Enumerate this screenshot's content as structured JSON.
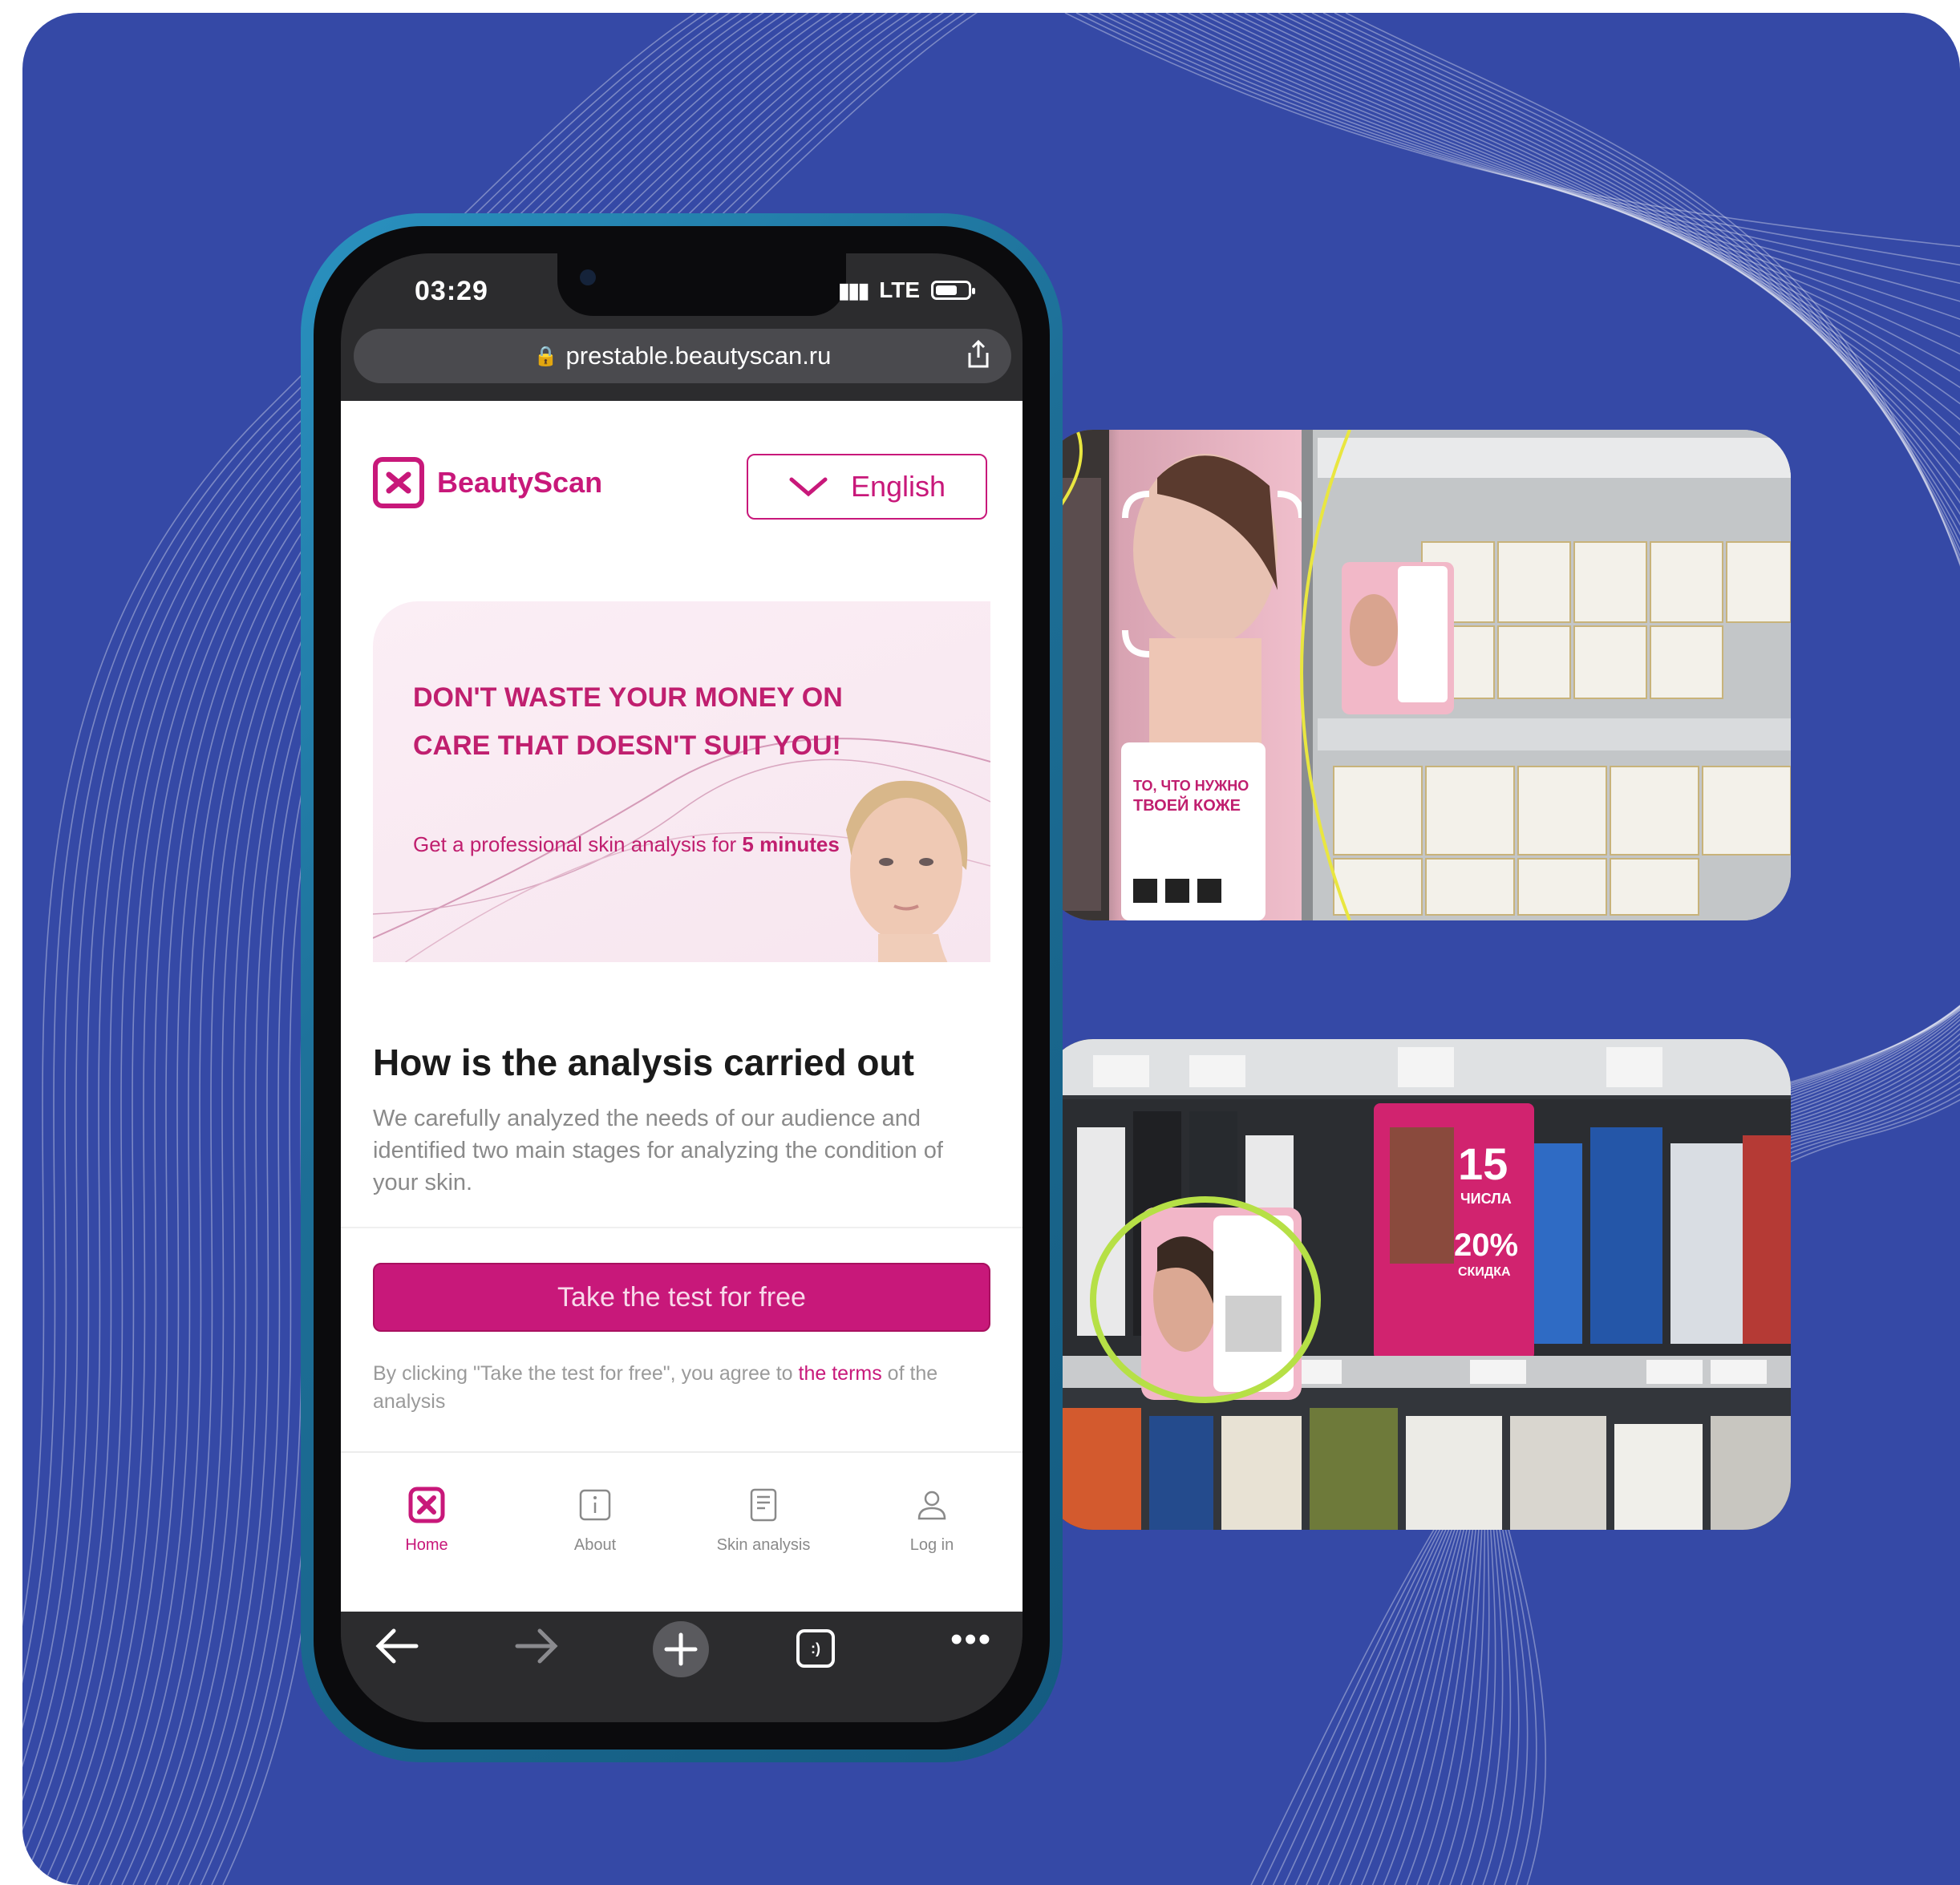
{
  "status": {
    "time": "03:29",
    "network": "LTE"
  },
  "browser": {
    "url": "prestable.beautyscan.ru"
  },
  "header": {
    "brand": "BeautyScan",
    "language": "English"
  },
  "hero": {
    "title": "DON'T WASTE YOUR MONEY ON CARE THAT DOESN'T SUIT YOU!",
    "subtitle_prefix": "Get a professional skin analysis for ",
    "subtitle_bold": "5 minutes"
  },
  "how": {
    "title": "How is the analysis carried out",
    "description": "We carefully analyzed the needs of our audience and identified two main stages for analyzing the condition of your skin."
  },
  "cta": {
    "label": "Take the test for free"
  },
  "terms": {
    "prefix": "By clicking \"Take the test for free\", you agree to ",
    "link": "the terms",
    "suffix": " of the analysis"
  },
  "tabs": [
    {
      "label": "Home",
      "icon": "beautyscan-logo-icon"
    },
    {
      "label": "About",
      "icon": "info-icon"
    },
    {
      "label": "Skin analysis",
      "icon": "document-icon"
    },
    {
      "label": "Log in",
      "icon": "user-icon"
    }
  ],
  "photo1": {
    "poster_line1": "ТО, ЧТО НУЖНО",
    "poster_line2": "ТВОЕЙ КОЖЕ"
  },
  "photo2": {
    "promo_day": "15",
    "promo_day_label": "ЧИСЛА",
    "promo_discount": "20%",
    "promo_discount_label": "СКИДКА"
  },
  "colors": {
    "background": "#3549a6",
    "brand": "#c8187a",
    "phone_frame": "#1d6f97",
    "highlight_yellow": "#e9e640",
    "highlight_green": "#b6e046"
  }
}
